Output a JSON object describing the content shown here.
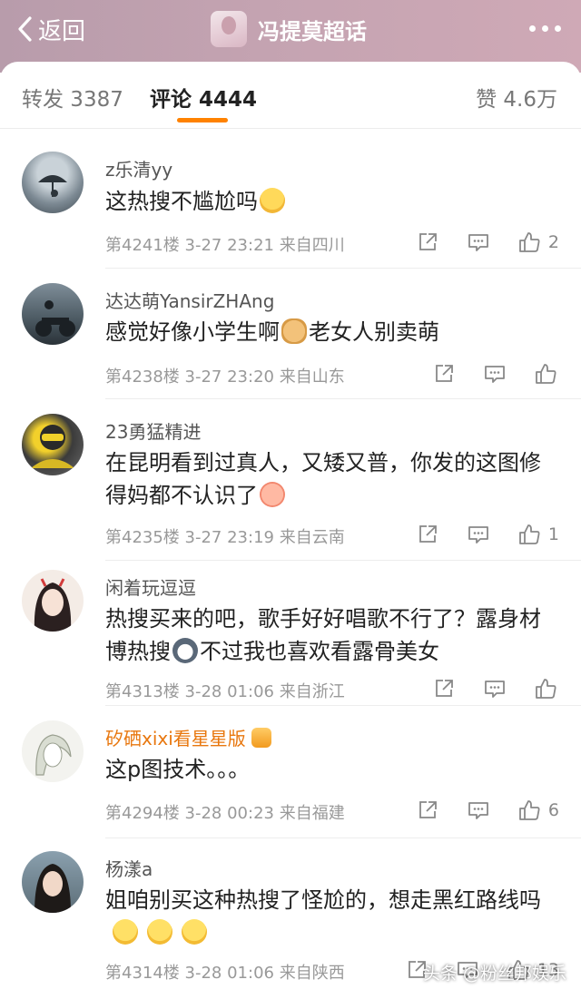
{
  "header": {
    "back_label": "返回",
    "title": "冯提莫超话"
  },
  "tabs": {
    "repost": "转发 3387",
    "comment": "评论 4444",
    "like": "赞 4.6万"
  },
  "comments": [
    {
      "user": "z乐清yy",
      "text": "这热搜不尴尬吗",
      "meta": "第4241楼 3-27 23:21 来自四川",
      "likes": "2"
    },
    {
      "user": "达达萌YansirZHAng",
      "text": "感觉好像小学生啊",
      "text2": "老女人别卖萌",
      "meta": "第4238楼 3-27 23:20 来自山东",
      "likes": ""
    },
    {
      "user": "23勇猛精进",
      "text": "在昆明看到过真人，又矮又普，你发的这图修得妈都不认识了",
      "meta": "第4235楼 3-27 23:19 来自云南",
      "likes": "1"
    },
    {
      "user": "闲着玩逗逗",
      "text": "热搜买来的吧，歌手好好唱歌不行了？露身材博热搜",
      "text2": "不过我也喜欢看露骨美女",
      "meta": "第4313楼 3-28 01:06 来自浙江",
      "likes": ""
    },
    {
      "user": "矽硒xixi看星星版",
      "text": "这p图技术。。。",
      "meta": "第4294楼 3-28 00:23 来自福建",
      "likes": "6"
    },
    {
      "user": "杨漾a",
      "text": "姐咱别买这种热搜了怪尬的，想走黑红路线吗",
      "meta": "第4314楼 3-28 01:06 来自陕西",
      "likes": "13"
    }
  ],
  "watermark": "头条 @粉丝邦娱乐",
  "colors": {
    "accent": "#ff8200",
    "vip_name": "#e8770e",
    "header_bg": "#c4a3b1"
  }
}
